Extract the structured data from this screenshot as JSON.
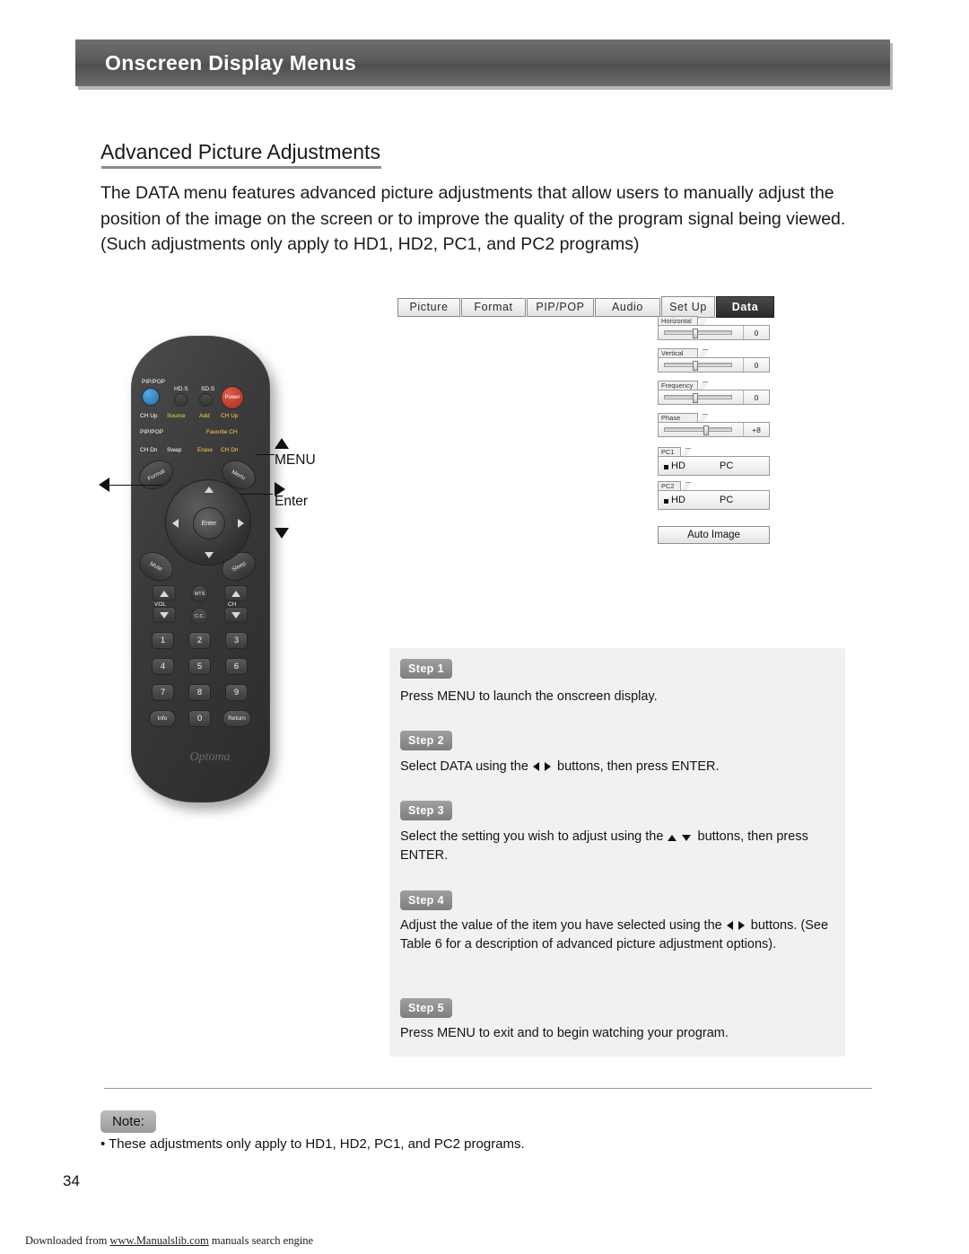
{
  "header": {
    "title": "Onscreen Display Menus"
  },
  "section": {
    "title": "Advanced Picture Adjustments"
  },
  "intro": "The DATA menu features advanced picture adjustments that allow users to manually adjust the position of the image on the screen or to improve the quality of the program signal being viewed. (Such adjustments only apply to HD1, HD2, PC1, and PC2 programs)",
  "osd": {
    "tabs": [
      {
        "label": "Picture",
        "active": false
      },
      {
        "label": "Format",
        "active": false
      },
      {
        "label": "PIP/POP",
        "active": false
      },
      {
        "label": "Audio",
        "active": false
      },
      {
        "label": "Set Up",
        "active": false
      },
      {
        "label": "Data",
        "active": true
      }
    ],
    "sliders": [
      {
        "label": "Horizontal",
        "value": "0",
        "knob_pct": 46
      },
      {
        "label": "Vertical",
        "value": "0",
        "knob_pct": 46
      },
      {
        "label": "Frequency",
        "value": "0",
        "knob_pct": 46
      },
      {
        "label": "Phase",
        "value": "+8",
        "knob_pct": 62
      }
    ],
    "sources": [
      {
        "label": "PC1",
        "selected": "HD",
        "option": "PC"
      },
      {
        "label": "PC2",
        "selected": "HD",
        "option": "PC"
      }
    ],
    "auto_image": "Auto Image"
  },
  "remote": {
    "brand": "Optoma",
    "top_labels": [
      "PIP/POP",
      "HD.S",
      "SD.S",
      "Power"
    ],
    "row_b": [
      "CH Up",
      "Source",
      "Add",
      "CH Up"
    ],
    "row_c": [
      "PIP/POP",
      "Favorite CH"
    ],
    "row_d": [
      "CH Dn",
      "Swap",
      "Erase",
      "CH Dn"
    ],
    "corners": [
      "Format",
      "Menu",
      "Mute",
      "Sleep"
    ],
    "enter": "Enter",
    "mid_labels": [
      "VOL",
      "MTS",
      "C.C.",
      "CH"
    ],
    "numpad": [
      "1",
      "2",
      "3",
      "4",
      "5",
      "6",
      "7",
      "8",
      "9",
      "Info",
      "0",
      "Return"
    ],
    "callouts": {
      "menu": "MENU",
      "enter": "Enter"
    }
  },
  "steps": [
    {
      "badge": "Step 1",
      "text": "Press MENU to launch the onscreen display."
    },
    {
      "badge": "Step 2",
      "text_pre": "Select DATA  using the",
      "text_post": "buttons, then press ENTER.",
      "arrows": "left-right"
    },
    {
      "badge": "Step 3",
      "text_pre": "Select the setting you wish to adjust  using the",
      "text_post": "buttons, then press ENTER.",
      "arrows": "up-down"
    },
    {
      "badge": "Step 4",
      "text_pre": "Adjust the value of the item you have selected using the",
      "text_post": "buttons.  (See Table 6 for a description of advanced picture adjustment options).",
      "arrows": "left-right"
    },
    {
      "badge": "Step 5",
      "text": "Press MENU to exit and to begin watching your program."
    }
  ],
  "note": {
    "badge": "Note:",
    "bullet": "•  These adjustments only apply to HD1, HD2, PC1, and PC2 programs."
  },
  "page_number": "34",
  "footer": {
    "pre": "Downloaded from ",
    "link": "www.Manualslib.com",
    "post": " manuals search engine"
  },
  "colors": {
    "accent_header": "#5a5a5a",
    "panel_bg": "#f1f1f1",
    "badge": "#8d8d8d",
    "power_red": "#c0392b",
    "source_blue": "#2b7ec1"
  }
}
